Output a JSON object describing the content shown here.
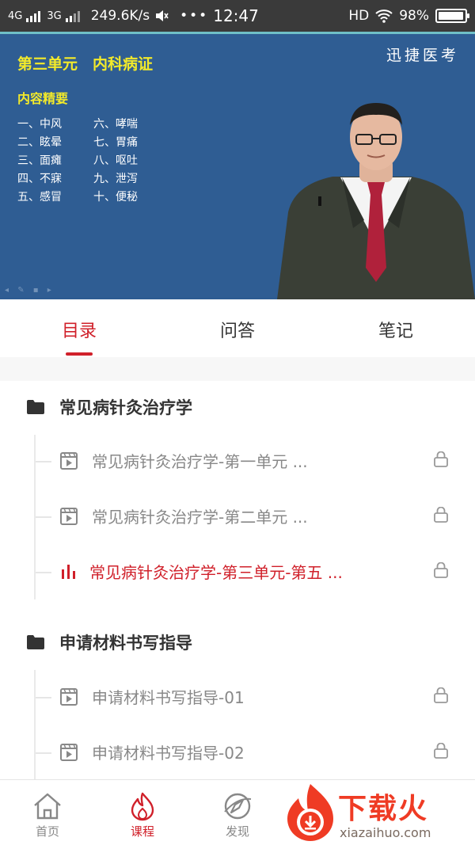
{
  "status_bar": {
    "network1": "4G",
    "network2": "3G",
    "speed": "249.6K/s",
    "more": "•••",
    "time": "12:47",
    "hd": "HD",
    "battery": "98%",
    "battery_level": 0.98
  },
  "video": {
    "title": "第三单元　内科病证",
    "brand": "迅捷医考",
    "subtitle": "内容精要",
    "items": [
      "一、中风",
      "六、哮喘",
      "二、眩晕",
      "七、胃痛",
      "三、面瘫",
      "八、呕吐",
      "四、不寐",
      "九、泄泻",
      "五、感冒",
      "十、便秘"
    ]
  },
  "tabs": [
    {
      "label": "目录",
      "active": true
    },
    {
      "label": "问答",
      "active": false
    },
    {
      "label": "笔记",
      "active": false
    }
  ],
  "chapters": [
    {
      "title": "常见病针灸治疗学",
      "lessons": [
        {
          "title": "常见病针灸治疗学-第一单元 ...",
          "active": false
        },
        {
          "title": "常见病针灸治疗学-第二单元 ...",
          "active": false
        },
        {
          "title": "常见病针灸治疗学-第三单元-第五 ...",
          "active": true
        }
      ]
    },
    {
      "title": "申请材料书写指导",
      "lessons": [
        {
          "title": "申请材料书写指导-01",
          "active": false
        },
        {
          "title": "申请材料书写指导-02",
          "active": false
        }
      ]
    }
  ],
  "bottom_nav": [
    {
      "label": "首页",
      "icon": "home-icon",
      "active": false
    },
    {
      "label": "课程",
      "icon": "flame-icon",
      "active": true
    },
    {
      "label": "发现",
      "icon": "compass-icon",
      "active": false
    }
  ],
  "watermark": {
    "title": "下载火",
    "url": "xiazaihuo.com"
  },
  "colors": {
    "accent": "#d0202a",
    "video_bg": "#2f5d93",
    "video_text": "#f3ea2a"
  }
}
